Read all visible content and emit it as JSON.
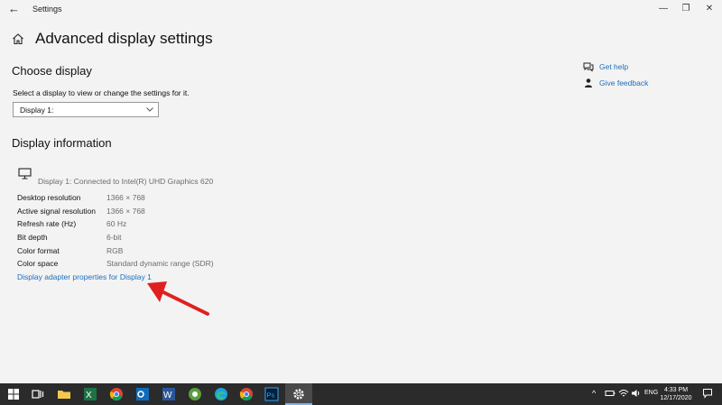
{
  "window": {
    "title": "Settings",
    "back_glyph": "←",
    "minimize_glyph": "—",
    "maximize_glyph": "❐",
    "close_glyph": "✕"
  },
  "page": {
    "title": "Advanced display settings"
  },
  "choose_display": {
    "heading": "Choose display",
    "instruction": "Select a display to view or change the settings for it.",
    "selected": "Display 1:"
  },
  "display_info": {
    "heading": "Display information",
    "connected": "Display 1: Connected to Intel(R) UHD Graphics 620",
    "rows": [
      {
        "label": "Desktop resolution",
        "value": "1366 × 768"
      },
      {
        "label": "Active signal resolution",
        "value": "1366 × 768"
      },
      {
        "label": "Refresh rate (Hz)",
        "value": "60 Hz"
      },
      {
        "label": "Bit depth",
        "value": "6-bit"
      },
      {
        "label": "Color format",
        "value": "RGB"
      },
      {
        "label": "Color space",
        "value": "Standard dynamic range (SDR)"
      }
    ],
    "adapter_link": "Display adapter properties for Display 1"
  },
  "help": {
    "get_help": "Get help",
    "give_feedback": "Give feedback"
  },
  "taskbar": {
    "apps": [
      "windows-start",
      "task-view",
      "file-explorer",
      "excel",
      "chrome",
      "outlook",
      "word",
      "app-green",
      "edge",
      "chrome",
      "photoshop",
      "settings"
    ],
    "tray_lang": "ENG",
    "time": "4:33 PM",
    "date": "12/17/2020"
  },
  "colors": {
    "accent_link": "#1a6fc2",
    "annotation_arrow": "#e02020",
    "taskbar": "#2b2b2b"
  }
}
